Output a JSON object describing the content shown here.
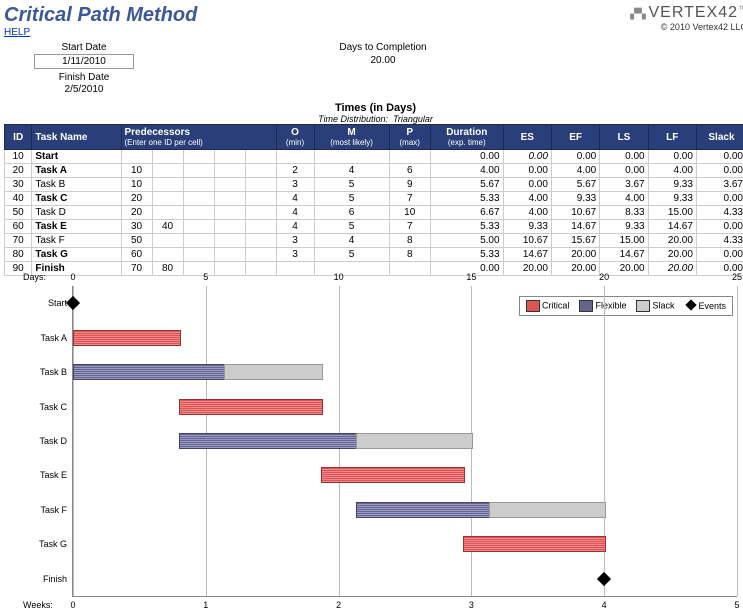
{
  "header": {
    "title": "Critical Path Method",
    "help": "HELP",
    "logo": "VERTEX42",
    "copyright": "© 2010 Vertex42 LLC"
  },
  "meta": {
    "start_label": "Start Date",
    "start_value": "1/11/2010",
    "finish_label": "Finish Date",
    "finish_value": "2/5/2010",
    "dtc_label": "Days to Completion",
    "dtc_value": "20.00"
  },
  "table": {
    "times_title": "Times (in Days)",
    "times_sub_label": "Time Distribution:",
    "times_sub_value": "Triangular",
    "cols": {
      "id": "ID",
      "name": "Task Name",
      "pred": "Predecessors",
      "pred_sub": "(Enter one ID per cell)",
      "o": "O",
      "o_sub": "(min)",
      "m": "M",
      "m_sub": "(most likely)",
      "p": "P",
      "p_sub": "(max)",
      "dur": "Duration",
      "dur_sub": "(exp. time)",
      "es": "ES",
      "ef": "EF",
      "ls": "LS",
      "lf": "LF",
      "slack": "Slack"
    },
    "rows": [
      {
        "id": "10",
        "name": "Start",
        "bold": true,
        "pred": [
          "",
          "",
          "",
          "",
          ""
        ],
        "o": "",
        "m": "",
        "p": "",
        "dur": "0.00",
        "es": "0.00",
        "es_it": true,
        "ef": "0.00",
        "ls": "0.00",
        "lf": "0.00",
        "slack": "0.00"
      },
      {
        "id": "20",
        "name": "Task A",
        "bold": true,
        "pred": [
          "10",
          "",
          "",
          "",
          ""
        ],
        "o": "2",
        "m": "4",
        "p": "6",
        "dur": "4.00",
        "es": "0.00",
        "ef": "4.00",
        "ls": "0.00",
        "lf": "4.00",
        "slack": "0.00"
      },
      {
        "id": "30",
        "name": "Task B",
        "pred": [
          "10",
          "",
          "",
          "",
          ""
        ],
        "o": "3",
        "m": "5",
        "p": "9",
        "dur": "5.67",
        "es": "0.00",
        "ef": "5.67",
        "ls": "3.67",
        "lf": "9.33",
        "slack": "3.67"
      },
      {
        "id": "40",
        "name": "Task C",
        "bold": true,
        "pred": [
          "20",
          "",
          "",
          "",
          ""
        ],
        "o": "4",
        "m": "5",
        "p": "7",
        "dur": "5.33",
        "es": "4.00",
        "ef": "9.33",
        "ls": "4.00",
        "lf": "9.33",
        "slack": "0.00"
      },
      {
        "id": "50",
        "name": "Task D",
        "pred": [
          "20",
          "",
          "",
          "",
          ""
        ],
        "o": "4",
        "m": "6",
        "p": "10",
        "dur": "6.67",
        "es": "4.00",
        "ef": "10.67",
        "ls": "8.33",
        "lf": "15.00",
        "slack": "4.33"
      },
      {
        "id": "60",
        "name": "Task E",
        "bold": true,
        "pred": [
          "30",
          "40",
          "",
          "",
          ""
        ],
        "o": "4",
        "m": "5",
        "p": "7",
        "dur": "5.33",
        "es": "9.33",
        "ef": "14.67",
        "ls": "9.33",
        "lf": "14.67",
        "slack": "0.00"
      },
      {
        "id": "70",
        "name": "Task F",
        "pred": [
          "50",
          "",
          "",
          "",
          ""
        ],
        "o": "3",
        "m": "4",
        "p": "8",
        "dur": "5.00",
        "es": "10.67",
        "ef": "15.67",
        "ls": "15.00",
        "lf": "20.00",
        "slack": "4.33"
      },
      {
        "id": "80",
        "name": "Task G",
        "bold": true,
        "pred": [
          "60",
          "",
          "",
          "",
          ""
        ],
        "o": "3",
        "m": "5",
        "p": "8",
        "dur": "5.33",
        "es": "14.67",
        "ef": "20.00",
        "ls": "14.67",
        "lf": "20.00",
        "slack": "0.00"
      },
      {
        "id": "90",
        "name": "Finish",
        "bold": true,
        "pred": [
          "70",
          "80",
          "",
          "",
          ""
        ],
        "o": "",
        "m": "",
        "p": "",
        "dur": "0.00",
        "es": "20.00",
        "ef": "20.00",
        "ls": "20.00",
        "lf": "20.00",
        "lf_it": true,
        "slack": "0.00"
      }
    ]
  },
  "chart_data": {
    "type": "gantt",
    "x_axis_top": {
      "label": "Days:",
      "min": 0,
      "max": 25,
      "ticks": [
        0,
        5,
        10,
        15,
        20,
        25
      ]
    },
    "x_axis_bottom": {
      "label": "Weeks:",
      "min": 0,
      "max": 5,
      "ticks": [
        0,
        1,
        2,
        3,
        4,
        5
      ]
    },
    "legend": [
      {
        "key": "Critical",
        "type": "crit"
      },
      {
        "key": "Flexible",
        "type": "flex"
      },
      {
        "key": "Slack",
        "type": "slack"
      },
      {
        "key": "Events",
        "type": "event"
      }
    ],
    "rows": [
      {
        "label": "Start",
        "segments": [
          {
            "type": "event",
            "at": 0
          }
        ]
      },
      {
        "label": "Task A",
        "segments": [
          {
            "type": "crit",
            "from": 0,
            "to": 4
          }
        ]
      },
      {
        "label": "Task B",
        "segments": [
          {
            "type": "flex",
            "from": 0,
            "to": 5.67
          },
          {
            "type": "slack",
            "from": 5.67,
            "to": 9.33
          }
        ]
      },
      {
        "label": "Task C",
        "segments": [
          {
            "type": "crit",
            "from": 4,
            "to": 9.33
          }
        ]
      },
      {
        "label": "Task D",
        "segments": [
          {
            "type": "flex",
            "from": 4,
            "to": 10.67
          },
          {
            "type": "slack",
            "from": 10.67,
            "to": 15
          }
        ]
      },
      {
        "label": "Task E",
        "segments": [
          {
            "type": "crit",
            "from": 9.33,
            "to": 14.67
          }
        ]
      },
      {
        "label": "Task F",
        "segments": [
          {
            "type": "flex",
            "from": 10.67,
            "to": 15.67
          },
          {
            "type": "slack",
            "from": 15.67,
            "to": 20
          }
        ]
      },
      {
        "label": "Task G",
        "segments": [
          {
            "type": "crit",
            "from": 14.67,
            "to": 20
          }
        ]
      },
      {
        "label": "Finish",
        "segments": [
          {
            "type": "event",
            "at": 20
          }
        ]
      }
    ]
  }
}
